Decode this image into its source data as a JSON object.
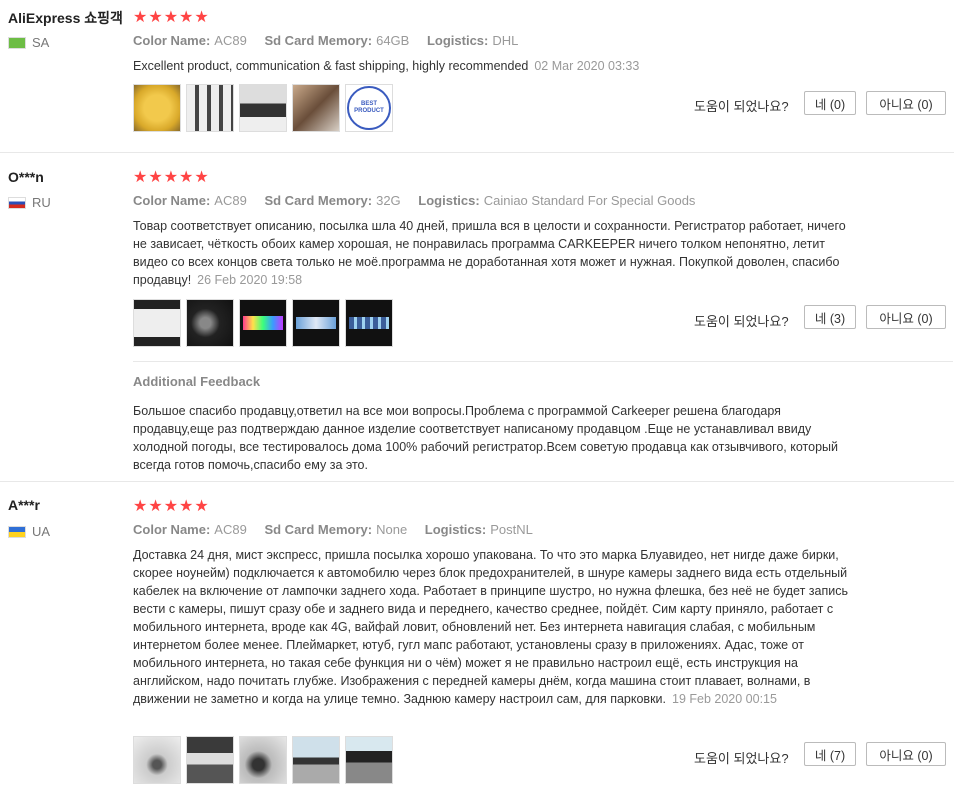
{
  "ui": {
    "helpful_question": "도움이 되었나요?",
    "rating_stars": "★★★★★",
    "attr_labels": {
      "color": "Color Name:",
      "sd": "Sd Card Memory:",
      "logistics": "Logistics:"
    },
    "additional_feedback_label": "Additional Feedback"
  },
  "reviews": [
    {
      "user": "AliExpress 쇼핑객",
      "country": "SA",
      "color": "AC89",
      "sd": "64GB",
      "logistics": "DHL",
      "text": "Excellent product, communication & fast shipping, highly recommended",
      "date": "02 Mar 2020 03:33",
      "yes": "네 (0)",
      "no": "아니요 (0)"
    },
    {
      "user": "O***n",
      "country": "RU",
      "color": "AC89",
      "sd": "32G",
      "logistics": "Cainiao Standard For Special Goods",
      "text": "Товар соответствует описанию, посылка шла 40 дней, пришла вся в целости и сохранности. Регистратор работает, ничего не зависает, чёткость обоих камер хорошая, не понравилась программа CARKEEPER ничего толком непонятно, летит видео со всех концов света только не моё.программа не доработанная хотя может и нужная. Покупкой доволен, спасибо продавцу!",
      "date": "26 Feb 2020 19:58",
      "yes": "네 (3)",
      "no": "아니요 (0)",
      "additional": "Большое спасибо продавцу,ответил на все мои вопросы.Проблема с программой Carkeeper решена благодаря продавцу,еще раз подтверждаю данное изделие соответствует написаному продавцом .Еще не устанавливал ввиду холодной погоды, все тестировалось дома 100% рабочий регистратор.Всем советую продавца как отзывчивого, который всегда готов помочь,спасибо ему за это."
    },
    {
      "user": "A***r",
      "country": "UA",
      "color": "AC89",
      "sd": "None",
      "logistics": "PostNL",
      "text": "Доставка 24 дня, мист экспресс, пришла посылка хорошо упакована. То что это марка Блуавидео, нет нигде даже бирки, скорее ноунейм) подключается к автомобилю через блок предохранителей, в шнуре камеры заднего вида есть отдельный кабелек на включение от лампочки заднего хода. Работает в принципе шустро, но нужна флешка, без неё не будет запись вести с камеры, пишут сразу обе и заднего вида и переднего, качество среднее, пойдёт. Сим карту приняло, работает с мобильного интернета, вроде как 4G, вайфай ловит, обновлений нет. Без интернета навигация слабая, с мобильным интернетом более менее. Плеймаркет, ютуб, гугл мапс работают, установлены сразу в приложениях. Адас, тоже от мобильного интернета, но такая себе функция ни о чём) может я не правильно настроил ещё, есть инструкция на английском, надо почитать глубже. Изображения с передней камеры днём, когда машина стоит плавает, волнами, в движении не заметно и когда на улице темно. Заднюю камеру настроил сам, для парковки.",
      "date": "19 Feb 2020 00:15",
      "yes": "네 (7)",
      "no": "아니요 (0)"
    }
  ],
  "badge_text": "BEST PRODUCT"
}
